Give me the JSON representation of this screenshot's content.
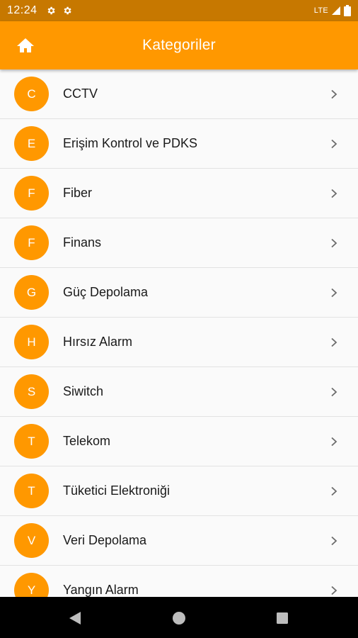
{
  "status_bar": {
    "time": "12:24",
    "network": "LTE",
    "icons": [
      "settings-icon",
      "settings-icon",
      "signal-icon",
      "battery-icon"
    ]
  },
  "app_bar": {
    "title": "Kategoriler",
    "left_icon": "home-icon",
    "color": "#ff9800"
  },
  "categories": [
    {
      "initial": "C",
      "label": "CCTV"
    },
    {
      "initial": "E",
      "label": "Erişim Kontrol ve PDKS"
    },
    {
      "initial": "F",
      "label": "Fiber"
    },
    {
      "initial": "F",
      "label": "Finans"
    },
    {
      "initial": "G",
      "label": "Güç Depolama"
    },
    {
      "initial": "H",
      "label": "Hırsız Alarm"
    },
    {
      "initial": "S",
      "label": "Siwitch"
    },
    {
      "initial": "T",
      "label": "Telekom"
    },
    {
      "initial": "T",
      "label": "Tüketici Elektroniği"
    },
    {
      "initial": "V",
      "label": "Veri Depolama"
    },
    {
      "initial": "Y",
      "label": "Yangın Alarm"
    }
  ],
  "row_trailing_icon": "chevron-right-icon",
  "nav_bar": {
    "buttons": [
      "back-icon",
      "home-circle-icon",
      "recent-apps-icon"
    ]
  }
}
